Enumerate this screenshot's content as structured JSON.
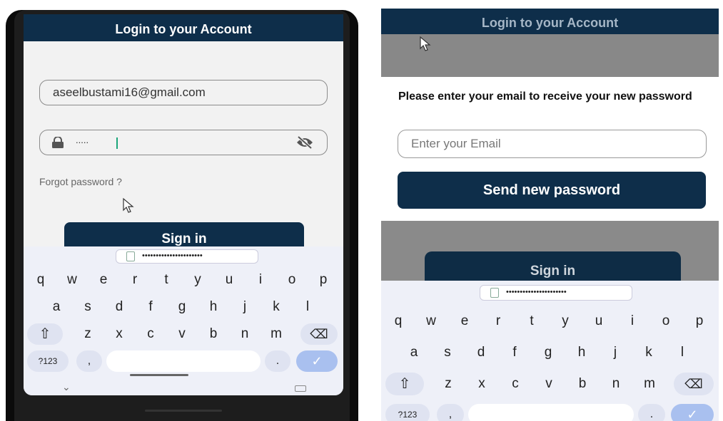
{
  "left": {
    "title": "Login to your Account",
    "email_value": "aseelbustami16@gmail.com",
    "password_mask": ".....",
    "forgot_label": "Forgot password ?",
    "signin_label": "Sign in",
    "clipboard_mask": "••••••••••••••••••••••"
  },
  "right": {
    "title": "Login to your Account",
    "sheet_title": "Please enter your email to receive your new password",
    "email_placeholder": "Enter your Email",
    "send_label": "Send new password",
    "signin_label": "Sign in",
    "clipboard_mask": "••••••••••••••••••••••"
  },
  "keyboard": {
    "row1": [
      "q",
      "w",
      "e",
      "r",
      "t",
      "y",
      "u",
      "i",
      "o",
      "p"
    ],
    "row2": [
      "a",
      "s",
      "d",
      "f",
      "g",
      "h",
      "j",
      "k",
      "l"
    ],
    "row3": [
      "z",
      "x",
      "c",
      "v",
      "b",
      "n",
      "m"
    ],
    "symbols_label": "?123",
    "comma_label": ",",
    "period_label": ".",
    "shift_glyph": "⇧",
    "backspace_glyph": "⌫",
    "enter_glyph": "✓",
    "hide_glyph": "⌄"
  },
  "colors": {
    "appbar": "#0e2e4a",
    "button": "#0e2e4a",
    "keyboard_bg": "#eef0f8",
    "enter_key": "#a9c0ef"
  }
}
